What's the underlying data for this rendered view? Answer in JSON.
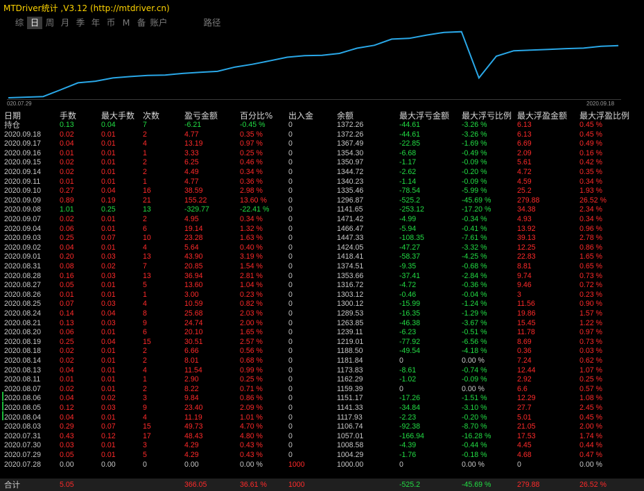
{
  "title": "MTDriver统计 ,V3.12 (http://mtdriver.cn)",
  "colors": {
    "profit": "#ff2a2a",
    "loss": "#22dd44",
    "neutral": "#c8c8c8",
    "line": "#2aa8e8",
    "title": "#ffd400"
  },
  "tabs": [
    {
      "label": "综",
      "active": false
    },
    {
      "label": "日",
      "active": true
    },
    {
      "label": "周",
      "active": false
    },
    {
      "label": "月",
      "active": false
    },
    {
      "label": "季",
      "active": false
    },
    {
      "label": "年",
      "active": false
    },
    {
      "label": "币",
      "active": false
    },
    {
      "label": "M",
      "active": false
    },
    {
      "label": "备",
      "active": false
    },
    {
      "label": "账户",
      "active": false
    },
    {
      "label": "路径",
      "active": false
    }
  ],
  "chart_data": {
    "type": "line",
    "x_start": "2020.07.29",
    "x_end": "2020.09.18",
    "x_start_label": "020.07.29",
    "series": [
      {
        "values": [
          1000,
          1004.29,
          1008.58,
          1057.01,
          1106.74,
          1117.93,
          1141.33,
          1151.17,
          1159.39,
          1162.29,
          1173.83,
          1181.84,
          1188.5,
          1219.01,
          1239.11,
          1263.85,
          1289.53,
          1300.12,
          1303.12,
          1316.72,
          1353.66,
          1374.51,
          1418.41,
          1424.05,
          1447.33,
          1466.47,
          1471.42,
          1141.65,
          1296.87,
          1335.46,
          1340.23,
          1344.72,
          1350.97,
          1354.3,
          1367.49,
          1372.26
        ]
      }
    ]
  },
  "columns": [
    "日期",
    "手数",
    "最大手数",
    "次数",
    "盈亏金额",
    "百分比%",
    "出入金",
    "余额",
    "最大浮亏金额",
    "最大浮亏比例",
    "最大浮盈金额",
    "最大浮盈比例"
  ],
  "rows": [
    [
      "持仓",
      "0.13",
      "0.04",
      "7",
      "-6.21",
      "-0.45 %",
      "0",
      "1372.26",
      "-44.61",
      "-3.26 %",
      "6.13",
      "0.45 %"
    ],
    [
      "2020.09.18",
      "0.02",
      "0.01",
      "2",
      "4.77",
      "0.35 %",
      "0",
      "1372.26",
      "-44.61",
      "-3.26 %",
      "6.13",
      "0.45 %"
    ],
    [
      "2020.09.17",
      "0.04",
      "0.01",
      "4",
      "13.19",
      "0.97 %",
      "0",
      "1367.49",
      "-22.85",
      "-1.69 %",
      "6.69",
      "0.49 %"
    ],
    [
      "2020.09.16",
      "0.01",
      "0.01",
      "1",
      "3.33",
      "0.25 %",
      "0",
      "1354.30",
      "-6.68",
      "-0.49 %",
      "2.09",
      "0.16 %"
    ],
    [
      "2020.09.15",
      "0.02",
      "0.01",
      "2",
      "6.25",
      "0.46 %",
      "0",
      "1350.97",
      "-1.17",
      "-0.09 %",
      "5.61",
      "0.42 %"
    ],
    [
      "2020.09.14",
      "0.02",
      "0.01",
      "2",
      "4.49",
      "0.34 %",
      "0",
      "1344.72",
      "-2.62",
      "-0.20 %",
      "4.72",
      "0.35 %"
    ],
    [
      "2020.09.11",
      "0.01",
      "0.01",
      "1",
      "4.77",
      "0.36 %",
      "0",
      "1340.23",
      "-1.14",
      "-0.09 %",
      "4.59",
      "0.34 %"
    ],
    [
      "2020.09.10",
      "0.27",
      "0.04",
      "16",
      "38.59",
      "2.98 %",
      "0",
      "1335.46",
      "-78.54",
      "-5.99 %",
      "25.2",
      "1.93 %"
    ],
    [
      "2020.09.09",
      "0.89",
      "0.19",
      "21",
      "155.22",
      "13.60 %",
      "0",
      "1296.87",
      "-525.2",
      "-45.69 %",
      "279.88",
      "26.52 %"
    ],
    [
      "2020.09.08",
      "1.01",
      "0.25",
      "13",
      "-329.77",
      "-22.41 %",
      "0",
      "1141.65",
      "-253.12",
      "-17.20 %",
      "34.38",
      "2.34 %"
    ],
    [
      "2020.09.07",
      "0.02",
      "0.01",
      "2",
      "4.95",
      "0.34 %",
      "0",
      "1471.42",
      "-4.99",
      "-0.34 %",
      "4.93",
      "0.34 %"
    ],
    [
      "2020.09.04",
      "0.06",
      "0.01",
      "6",
      "19.14",
      "1.32 %",
      "0",
      "1466.47",
      "-5.94",
      "-0.41 %",
      "13.92",
      "0.96 %"
    ],
    [
      "2020.09.03",
      "0.25",
      "0.07",
      "10",
      "23.28",
      "1.63 %",
      "0",
      "1447.33",
      "-108.35",
      "-7.61 %",
      "39.13",
      "2.78 %"
    ],
    [
      "2020.09.02",
      "0.04",
      "0.01",
      "4",
      "5.64",
      "0.40 %",
      "0",
      "1424.05",
      "-47.27",
      "-3.32 %",
      "12.25",
      "0.86 %"
    ],
    [
      "2020.09.01",
      "0.20",
      "0.03",
      "13",
      "43.90",
      "3.19 %",
      "0",
      "1418.41",
      "-58.37",
      "-4.25 %",
      "22.83",
      "1.65 %"
    ],
    [
      "2020.08.31",
      "0.08",
      "0.02",
      "7",
      "20.85",
      "1.54 %",
      "0",
      "1374.51",
      "-9.35",
      "-0.68 %",
      "8.81",
      "0.65 %"
    ],
    [
      "2020.08.28",
      "0.16",
      "0.03",
      "13",
      "36.94",
      "2.81 %",
      "0",
      "1353.66",
      "-37.41",
      "-2.84 %",
      "9.74",
      "0.73 %"
    ],
    [
      "2020.08.27",
      "0.05",
      "0.01",
      "5",
      "13.60",
      "1.04 %",
      "0",
      "1316.72",
      "-4.72",
      "-0.36 %",
      "9.46",
      "0.72 %"
    ],
    [
      "2020.08.26",
      "0.01",
      "0.01",
      "1",
      "3.00",
      "0.23 %",
      "0",
      "1303.12",
      "-0.46",
      "-0.04 %",
      "3",
      "0.23 %"
    ],
    [
      "2020.08.25",
      "0.07",
      "0.03",
      "4",
      "10.59",
      "0.82 %",
      "0",
      "1300.12",
      "-15.99",
      "-1.24 %",
      "11.56",
      "0.90 %"
    ],
    [
      "2020.08.24",
      "0.14",
      "0.04",
      "8",
      "25.68",
      "2.03 %",
      "0",
      "1289.53",
      "-16.35",
      "-1.29 %",
      "19.86",
      "1.57 %"
    ],
    [
      "2020.08.21",
      "0.13",
      "0.03",
      "9",
      "24.74",
      "2.00 %",
      "0",
      "1263.85",
      "-46.38",
      "-3.67 %",
      "15.45",
      "1.22 %"
    ],
    [
      "2020.08.20",
      "0.06",
      "0.01",
      "6",
      "20.10",
      "1.65 %",
      "0",
      "1239.11",
      "-6.23",
      "-0.51 %",
      "11.78",
      "0.97 %"
    ],
    [
      "2020.08.19",
      "0.25",
      "0.04",
      "15",
      "30.51",
      "2.57 %",
      "0",
      "1219.01",
      "-77.92",
      "-6.56 %",
      "8.69",
      "0.73 %"
    ],
    [
      "2020.08.18",
      "0.02",
      "0.01",
      "2",
      "6.66",
      "0.56 %",
      "0",
      "1188.50",
      "-49.54",
      "-4.18 %",
      "0.36",
      "0.03 %"
    ],
    [
      "2020.08.14",
      "0.02",
      "0.01",
      "2",
      "8.01",
      "0.68 %",
      "0",
      "1181.84",
      "0",
      "0.00 %",
      "7.24",
      "0.62 %"
    ],
    [
      "2020.08.13",
      "0.04",
      "0.01",
      "4",
      "11.54",
      "0.99 %",
      "0",
      "1173.83",
      "-8.61",
      "-0.74 %",
      "12.44",
      "1.07 %"
    ],
    [
      "2020.08.11",
      "0.01",
      "0.01",
      "1",
      "2.90",
      "0.25 %",
      "0",
      "1162.29",
      "-1.02",
      "-0.09 %",
      "2.92",
      "0.25 %"
    ],
    [
      "2020.08.07",
      "0.02",
      "0.01",
      "2",
      "8.22",
      "0.71 %",
      "0",
      "1159.39",
      "0",
      "0.00 %",
      "6.6",
      "0.57 %"
    ],
    [
      "2020.08.06",
      "0.04",
      "0.02",
      "3",
      "9.84",
      "0.86 %",
      "0",
      "1151.17",
      "-17.26",
      "-1.51 %",
      "12.29",
      "1.08 %"
    ],
    [
      "2020.08.05",
      "0.12",
      "0.03",
      "9",
      "23.40",
      "2.09 %",
      "0",
      "1141.33",
      "-34.84",
      "-3.10 %",
      "27.7",
      "2.45 %"
    ],
    [
      "2020.08.04",
      "0.04",
      "0.01",
      "4",
      "11.19",
      "1.01 %",
      "0",
      "1117.93",
      "-2.23",
      "-0.20 %",
      "5.01",
      "0.45 %"
    ],
    [
      "2020.08.03",
      "0.29",
      "0.07",
      "15",
      "49.73",
      "4.70 %",
      "0",
      "1106.74",
      "-92.38",
      "-8.70 %",
      "21.05",
      "2.00 %"
    ],
    [
      "2020.07.31",
      "0.43",
      "0.12",
      "17",
      "48.43",
      "4.80 %",
      "0",
      "1057.01",
      "-166.94",
      "-16.28 %",
      "17.53",
      "1.74 %"
    ],
    [
      "2020.07.30",
      "0.03",
      "0.01",
      "3",
      "4.29",
      "0.43 %",
      "0",
      "1008.58",
      "-4.39",
      "-0.44 %",
      "4.45",
      "0.44 %"
    ],
    [
      "2020.07.29",
      "0.05",
      "0.01",
      "5",
      "4.29",
      "0.43 %",
      "0",
      "1004.29",
      "-1.76",
      "-0.18 %",
      "4.68",
      "0.47 %"
    ],
    [
      "2020.07.28",
      "0.00",
      "0.00",
      "0",
      "0.00",
      "0.00 %",
      "1000",
      "1000.00",
      "0",
      "0.00 %",
      "0",
      "0.00 %"
    ]
  ],
  "summary": [
    "合计",
    "5.05",
    "",
    "",
    "366.05",
    "36.61 %",
    "1000",
    "",
    "-525.2",
    "-45.69 %",
    "279.88",
    "26.52 %"
  ]
}
